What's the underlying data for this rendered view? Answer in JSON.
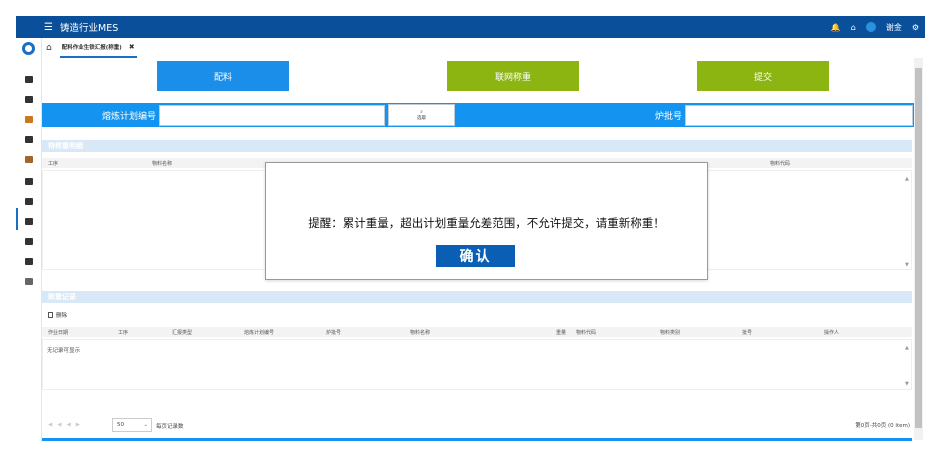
{
  "header": {
    "title": "铸造行业MES",
    "user": "谢金"
  },
  "tabs": [
    {
      "label": "配料作业生铁汇报(称重)"
    }
  ],
  "actions": {
    "batching": "配料",
    "network_weigh": "联网称重",
    "submit": "提交"
  },
  "form": {
    "plan_label": "熔炼计划编号",
    "pick_label": "选取",
    "heat_label": "炉批号"
  },
  "pending": {
    "title": "待称重明细",
    "columns": [
      "工序",
      "物料名称",
      "",
      "",
      "",
      "物料代码"
    ]
  },
  "records": {
    "title": "称重记录",
    "delete_label": "删除",
    "columns": [
      "作业日期",
      "工序",
      "汇报类型",
      "熔炼计划编号",
      "炉批号",
      "物料名称",
      "重量",
      "物料代码",
      "物料类别",
      "批号",
      "操作人"
    ],
    "empty_text": "无记录可显示"
  },
  "pager": {
    "page_size": "50",
    "per_page_label": "每页记录数",
    "info": "第0页-共0页 (0 item)"
  },
  "dialog": {
    "message": "提醒：累计重量，超出计划重量允差范围，不允许提交，请重新称重！",
    "confirm": "确认"
  },
  "colors": {
    "header": "#0a4f9a",
    "primary": "#1494f0",
    "green": "#8db511"
  }
}
